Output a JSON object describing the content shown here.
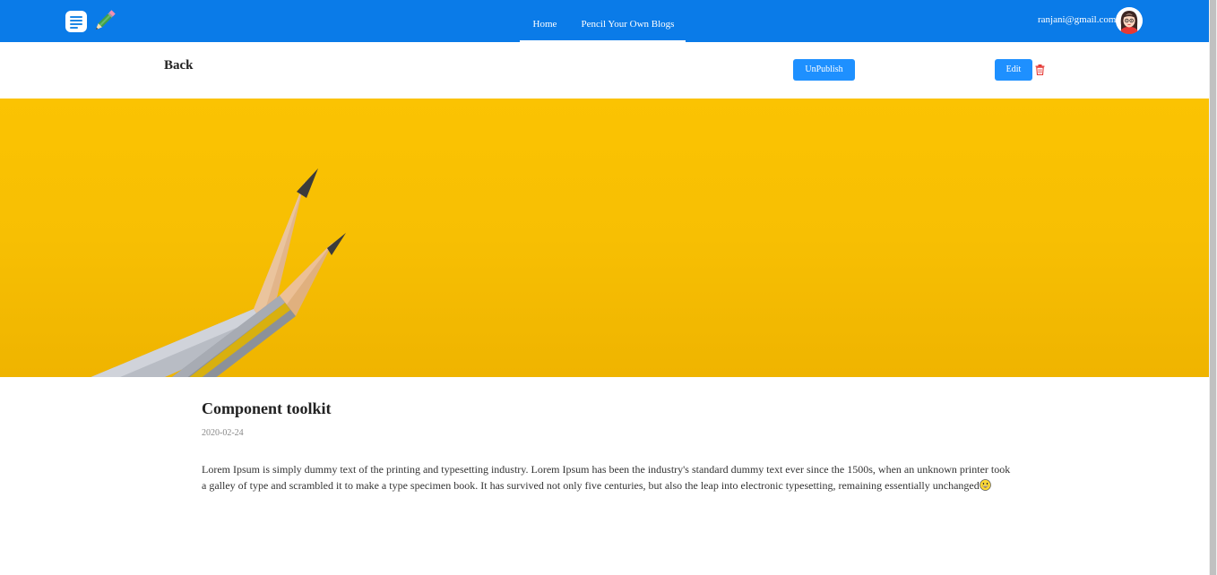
{
  "header": {
    "logo_icons": [
      "note-icon",
      "pencil-icon"
    ],
    "nav": [
      {
        "label": "Home"
      },
      {
        "label": "Pencil Your Own Blogs"
      }
    ],
    "user_email": "ranjani@gmail.com",
    "brand_color": "#0a7be8"
  },
  "actions": {
    "back_label": "Back",
    "unpublish_label": "UnPublish",
    "edit_label": "Edit",
    "delete_icon": "trash-icon",
    "button_color": "#1e90ff",
    "delete_color": "#e53935"
  },
  "post": {
    "title": "Component toolkit",
    "date": "2020-02-24",
    "body": "Lorem Ipsum is simply dummy text of the printing and typesetting industry. Lorem Ipsum has been the industry's standard dummy text ever since the 1500s, when an unknown printer took a galley of type and scrambled it to make a type specimen book. It has survived not only five centuries, but also the leap into electronic typesetting, remaining essentially unchanged",
    "body_emoji": "grinning-face-icon",
    "hero_image": "two-pencils-on-yellow-background"
  }
}
